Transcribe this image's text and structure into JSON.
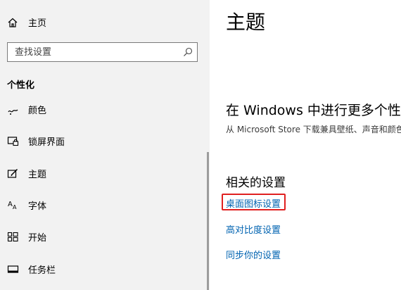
{
  "sidebar": {
    "home_label": "主页",
    "search": {
      "placeholder": "查找设置",
      "value": ""
    },
    "section_title": "个性化",
    "items": [
      {
        "label": "颜色",
        "icon": "palette-icon"
      },
      {
        "label": "锁屏界面",
        "icon": "lock-screen-icon"
      },
      {
        "label": "主题",
        "icon": "theme-icon"
      },
      {
        "label": "字体",
        "icon": "font-icon"
      },
      {
        "label": "开始",
        "icon": "start-icon"
      },
      {
        "label": "任务栏",
        "icon": "taskbar-icon"
      }
    ]
  },
  "main": {
    "title": "主题",
    "store_heading": "在 Windows 中进行更多个性化",
    "store_desc": "从 Microsoft Store 下载兼具壁纸、声音和颜色",
    "related_heading": "相关的设置",
    "links": [
      {
        "label": "桌面图标设置",
        "highlighted": true
      },
      {
        "label": "高对比度设置"
      },
      {
        "label": "同步你的设置"
      }
    ]
  },
  "colors": {
    "sidebar_bg": "#f2f2f2",
    "link": "#0063b1",
    "highlight": "#e02020"
  }
}
